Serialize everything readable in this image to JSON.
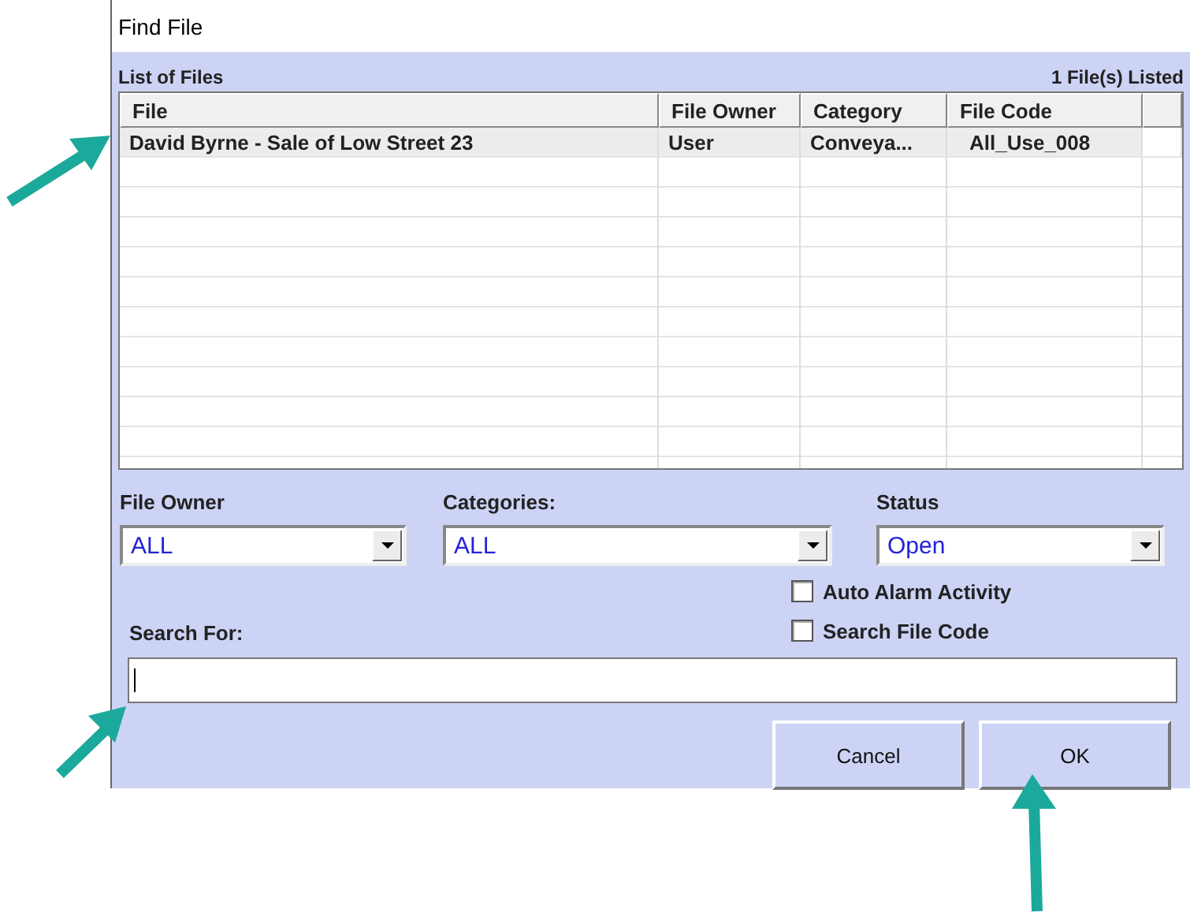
{
  "window": {
    "title": "Find File"
  },
  "list": {
    "label": "List of Files",
    "count": "1 File(s) Listed",
    "columns": [
      "File",
      "File Owner",
      "Category",
      "File Code"
    ],
    "rows": [
      {
        "cells": [
          "David Byrne - Sale of Low Street 23",
          "User",
          "Conveya...",
          "All_Use_008"
        ],
        "selected": true
      }
    ]
  },
  "filters": [
    {
      "label": "File Owner",
      "value": "ALL"
    },
    {
      "label": "Categories:",
      "value": "ALL"
    },
    {
      "label": "Status",
      "value": "Open"
    }
  ],
  "options": [
    {
      "label": "Auto Alarm Activity",
      "checked": false
    },
    {
      "label": "Search File Code",
      "checked": false
    }
  ],
  "search": {
    "label": "Search For:"
  },
  "buttons": [
    {
      "label": "Cancel"
    },
    {
      "label": "OK"
    }
  ]
}
